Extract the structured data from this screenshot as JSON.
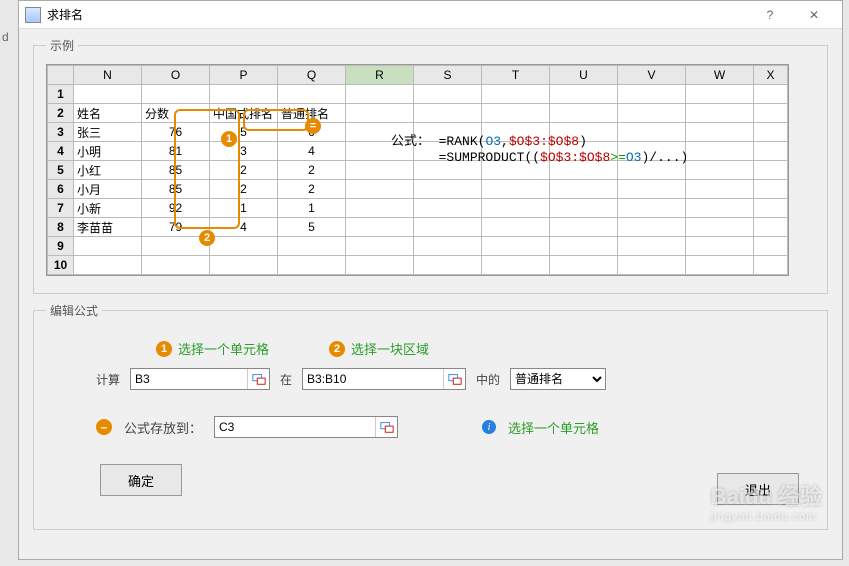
{
  "title": "求排名",
  "left_char": "d",
  "example_legend": "示例",
  "edit_legend": "编辑公式",
  "cols": [
    "N",
    "O",
    "P",
    "Q",
    "R",
    "S",
    "T",
    "U",
    "V",
    "W",
    "X"
  ],
  "rownums": [
    "1",
    "2",
    "3",
    "4",
    "5",
    "6",
    "7",
    "8",
    "9",
    "10"
  ],
  "headers": {
    "name": "姓名",
    "score": "分数",
    "cnrank": "中国式排名",
    "rank": "普通排名"
  },
  "rows": [
    {
      "name": "张三",
      "score": "76",
      "cn": "5",
      "pt": "6"
    },
    {
      "name": "小明",
      "score": "81",
      "cn": "3",
      "pt": "4"
    },
    {
      "name": "小红",
      "score": "85",
      "cn": "2",
      "pt": "2"
    },
    {
      "name": "小月",
      "score": "85",
      "cn": "2",
      "pt": "2"
    },
    {
      "name": "小新",
      "score": "92",
      "cn": "1",
      "pt": "1"
    },
    {
      "name": "李苗苗",
      "score": "79",
      "cn": "4",
      "pt": "5"
    }
  ],
  "formula_label": "公式：",
  "formula1": {
    "a": "=RANK(",
    "b": "O3",
    "c": ",",
    "d": "$O$3:$O$8",
    "e": ")"
  },
  "formula2": {
    "a": "=SUMPRODUCT((",
    "b": "$O$3:$O$8",
    "c": ">=",
    "d": "O3",
    "e": ")/...)"
  },
  "tip1": "选择一个单元格",
  "tip2": "选择一块区域",
  "calc_label": "计算",
  "calc_value": "B3",
  "in_label": "在",
  "range_value": "B3:B10",
  "of_label": "中的",
  "kind_value": "普通排名",
  "store_label": "公式存放到：",
  "store_value": "C3",
  "store_tip": "选择一个单元格",
  "ok": "确定",
  "exit": "退出",
  "wm1": "Baidu 经验",
  "wm2": "jingyan.baidu.com",
  "chart_data": {
    "type": "table",
    "title": "求排名 示例",
    "columns": [
      "姓名",
      "分数",
      "中国式排名",
      "普通排名"
    ],
    "rows": [
      [
        "张三",
        76,
        5,
        6
      ],
      [
        "小明",
        81,
        3,
        4
      ],
      [
        "小红",
        85,
        2,
        2
      ],
      [
        "小月",
        85,
        2,
        2
      ],
      [
        "小新",
        92,
        1,
        1
      ],
      [
        "李苗苗",
        79,
        4,
        5
      ]
    ],
    "formulas": [
      "=RANK(O3,$O$3:$O$8)",
      "=SUMPRODUCT(($O$3:$O$8>=O3)/...)"
    ]
  }
}
